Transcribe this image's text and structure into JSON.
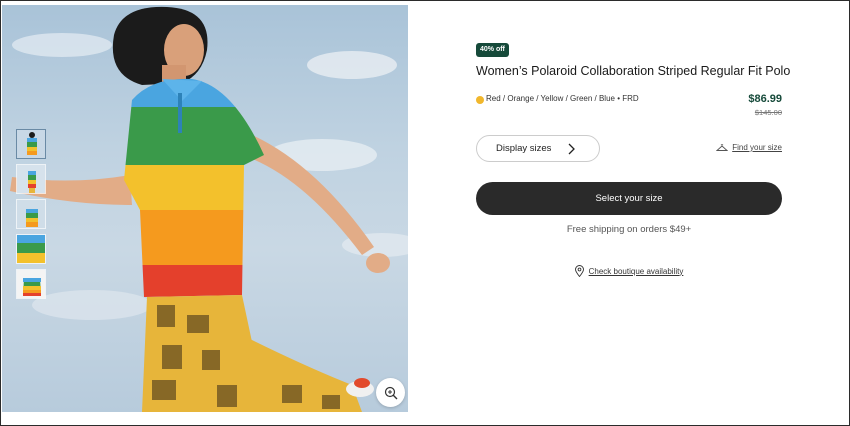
{
  "product": {
    "discount_badge": "40% off",
    "title": "Women’s Polaroid Collaboration Striped Regular Fit Polo",
    "color_label": "Red / Orange / Yellow / Green / Blue • FRD",
    "price": "$86.99",
    "original_price": "$145.00"
  },
  "actions": {
    "display_sizes": "Display sizes",
    "find_your_size": "Find your size",
    "select_your_size": "Select your size",
    "shipping": "Free shipping on orders $49+",
    "check_boutique": "Check boutique availability"
  },
  "gallery": {
    "thumbnail_count": 5,
    "active_thumbnail": 1
  },
  "colors": {
    "accent": "#164a3a",
    "button": "#2a2a2a",
    "swatch": "#f1b72c"
  }
}
